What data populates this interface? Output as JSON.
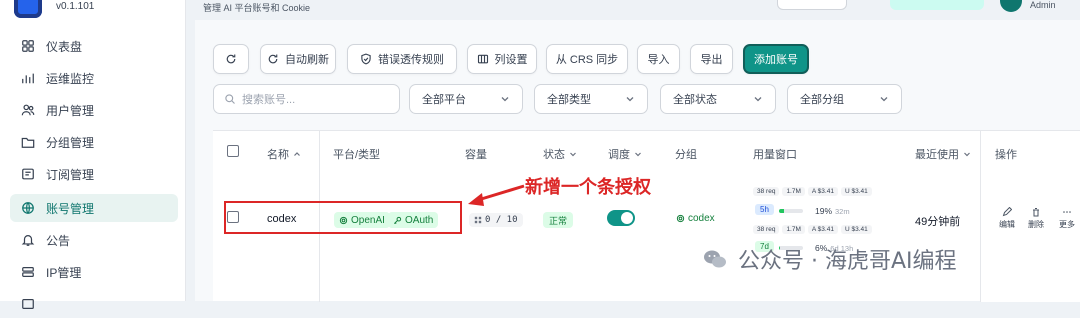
{
  "sidebar": {
    "version": "v0.1.101",
    "items": [
      {
        "label": "仪表盘",
        "icon": "dashboard-icon"
      },
      {
        "label": "运维监控",
        "icon": "chart-icon"
      },
      {
        "label": "用户管理",
        "icon": "users-icon"
      },
      {
        "label": "分组管理",
        "icon": "folder-icon"
      },
      {
        "label": "订阅管理",
        "icon": "subscription-icon"
      },
      {
        "label": "账号管理",
        "icon": "globe-icon",
        "active": true
      },
      {
        "label": "公告",
        "icon": "bell-icon"
      },
      {
        "label": "IP管理",
        "icon": "server-icon"
      }
    ]
  },
  "header": {
    "subtitle": "管理 AI 平台账号和 Cookie",
    "user": "Admin"
  },
  "toolbar": {
    "refresh": "",
    "auto_refresh": "自动刷新",
    "error_rules": "错误透传规则",
    "columns": "列设置",
    "crs_sync": "从 CRS 同步",
    "import": "导入",
    "export": "导出",
    "add_account": "添加账号"
  },
  "filters": {
    "search_placeholder": "搜索账号...",
    "platform": "全部平台",
    "type": "全部类型",
    "status": "全部状态",
    "group": "全部分组"
  },
  "table": {
    "headers": {
      "name": "名称",
      "platform": "平台/类型",
      "capacity": "容量",
      "status": "状态",
      "schedule": "调度",
      "group": "分组",
      "usage": "用量窗口",
      "recent": "最近使用",
      "ops": "操作"
    },
    "row": {
      "name": "codex",
      "platform": "OpenAI",
      "auth": "OAuth",
      "capacity": "0 / 10",
      "status": "正常",
      "schedule_on": true,
      "group": "codex",
      "usage": {
        "w1": {
          "req": "38 req",
          "tokens": "1.7M",
          "a": "A $3.41",
          "u": "U $3.41",
          "badge": "5h",
          "pct": "19%",
          "reset": "32m",
          "fill": 0.19
        },
        "w2": {
          "req": "38 req",
          "tokens": "1.7M",
          "a": "A $3.41",
          "u": "U $3.41",
          "badge": "7d",
          "pct": "6%",
          "reset": "6d 13h",
          "fill": 0.06
        }
      },
      "recent": "49分钟前",
      "ops": {
        "edit": "编辑",
        "delete": "删除",
        "more": "更多"
      }
    }
  },
  "annotation": {
    "text": "新增一个条授权"
  },
  "watermark": {
    "text": "公众号 · 海虎哥AI编程"
  },
  "colors": {
    "accent": "#0f9488",
    "annotation": "#dc2626",
    "active_bg": "#e8f3f1"
  }
}
